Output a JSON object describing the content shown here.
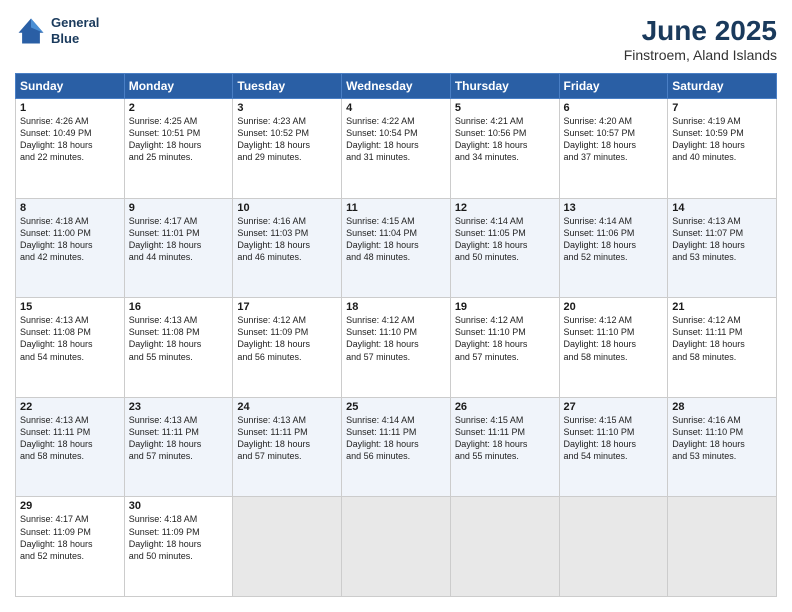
{
  "header": {
    "logo_line1": "General",
    "logo_line2": "Blue",
    "title": "June 2025",
    "location": "Finstroem, Aland Islands"
  },
  "weekdays": [
    "Sunday",
    "Monday",
    "Tuesday",
    "Wednesday",
    "Thursday",
    "Friday",
    "Saturday"
  ],
  "weeks": [
    [
      {
        "day": "1",
        "lines": [
          "Sunrise: 4:26 AM",
          "Sunset: 10:49 PM",
          "Daylight: 18 hours",
          "and 22 minutes."
        ]
      },
      {
        "day": "2",
        "lines": [
          "Sunrise: 4:25 AM",
          "Sunset: 10:51 PM",
          "Daylight: 18 hours",
          "and 25 minutes."
        ]
      },
      {
        "day": "3",
        "lines": [
          "Sunrise: 4:23 AM",
          "Sunset: 10:52 PM",
          "Daylight: 18 hours",
          "and 29 minutes."
        ]
      },
      {
        "day": "4",
        "lines": [
          "Sunrise: 4:22 AM",
          "Sunset: 10:54 PM",
          "Daylight: 18 hours",
          "and 31 minutes."
        ]
      },
      {
        "day": "5",
        "lines": [
          "Sunrise: 4:21 AM",
          "Sunset: 10:56 PM",
          "Daylight: 18 hours",
          "and 34 minutes."
        ]
      },
      {
        "day": "6",
        "lines": [
          "Sunrise: 4:20 AM",
          "Sunset: 10:57 PM",
          "Daylight: 18 hours",
          "and 37 minutes."
        ]
      },
      {
        "day": "7",
        "lines": [
          "Sunrise: 4:19 AM",
          "Sunset: 10:59 PM",
          "Daylight: 18 hours",
          "and 40 minutes."
        ]
      }
    ],
    [
      {
        "day": "8",
        "lines": [
          "Sunrise: 4:18 AM",
          "Sunset: 11:00 PM",
          "Daylight: 18 hours",
          "and 42 minutes."
        ]
      },
      {
        "day": "9",
        "lines": [
          "Sunrise: 4:17 AM",
          "Sunset: 11:01 PM",
          "Daylight: 18 hours",
          "and 44 minutes."
        ]
      },
      {
        "day": "10",
        "lines": [
          "Sunrise: 4:16 AM",
          "Sunset: 11:03 PM",
          "Daylight: 18 hours",
          "and 46 minutes."
        ]
      },
      {
        "day": "11",
        "lines": [
          "Sunrise: 4:15 AM",
          "Sunset: 11:04 PM",
          "Daylight: 18 hours",
          "and 48 minutes."
        ]
      },
      {
        "day": "12",
        "lines": [
          "Sunrise: 4:14 AM",
          "Sunset: 11:05 PM",
          "Daylight: 18 hours",
          "and 50 minutes."
        ]
      },
      {
        "day": "13",
        "lines": [
          "Sunrise: 4:14 AM",
          "Sunset: 11:06 PM",
          "Daylight: 18 hours",
          "and 52 minutes."
        ]
      },
      {
        "day": "14",
        "lines": [
          "Sunrise: 4:13 AM",
          "Sunset: 11:07 PM",
          "Daylight: 18 hours",
          "and 53 minutes."
        ]
      }
    ],
    [
      {
        "day": "15",
        "lines": [
          "Sunrise: 4:13 AM",
          "Sunset: 11:08 PM",
          "Daylight: 18 hours",
          "and 54 minutes."
        ]
      },
      {
        "day": "16",
        "lines": [
          "Sunrise: 4:13 AM",
          "Sunset: 11:08 PM",
          "Daylight: 18 hours",
          "and 55 minutes."
        ]
      },
      {
        "day": "17",
        "lines": [
          "Sunrise: 4:12 AM",
          "Sunset: 11:09 PM",
          "Daylight: 18 hours",
          "and 56 minutes."
        ]
      },
      {
        "day": "18",
        "lines": [
          "Sunrise: 4:12 AM",
          "Sunset: 11:10 PM",
          "Daylight: 18 hours",
          "and 57 minutes."
        ]
      },
      {
        "day": "19",
        "lines": [
          "Sunrise: 4:12 AM",
          "Sunset: 11:10 PM",
          "Daylight: 18 hours",
          "and 57 minutes."
        ]
      },
      {
        "day": "20",
        "lines": [
          "Sunrise: 4:12 AM",
          "Sunset: 11:10 PM",
          "Daylight: 18 hours",
          "and 58 minutes."
        ]
      },
      {
        "day": "21",
        "lines": [
          "Sunrise: 4:12 AM",
          "Sunset: 11:11 PM",
          "Daylight: 18 hours",
          "and 58 minutes."
        ]
      }
    ],
    [
      {
        "day": "22",
        "lines": [
          "Sunrise: 4:13 AM",
          "Sunset: 11:11 PM",
          "Daylight: 18 hours",
          "and 58 minutes."
        ]
      },
      {
        "day": "23",
        "lines": [
          "Sunrise: 4:13 AM",
          "Sunset: 11:11 PM",
          "Daylight: 18 hours",
          "and 57 minutes."
        ]
      },
      {
        "day": "24",
        "lines": [
          "Sunrise: 4:13 AM",
          "Sunset: 11:11 PM",
          "Daylight: 18 hours",
          "and 57 minutes."
        ]
      },
      {
        "day": "25",
        "lines": [
          "Sunrise: 4:14 AM",
          "Sunset: 11:11 PM",
          "Daylight: 18 hours",
          "and 56 minutes."
        ]
      },
      {
        "day": "26",
        "lines": [
          "Sunrise: 4:15 AM",
          "Sunset: 11:11 PM",
          "Daylight: 18 hours",
          "and 55 minutes."
        ]
      },
      {
        "day": "27",
        "lines": [
          "Sunrise: 4:15 AM",
          "Sunset: 11:10 PM",
          "Daylight: 18 hours",
          "and 54 minutes."
        ]
      },
      {
        "day": "28",
        "lines": [
          "Sunrise: 4:16 AM",
          "Sunset: 11:10 PM",
          "Daylight: 18 hours",
          "and 53 minutes."
        ]
      }
    ],
    [
      {
        "day": "29",
        "lines": [
          "Sunrise: 4:17 AM",
          "Sunset: 11:09 PM",
          "Daylight: 18 hours",
          "and 52 minutes."
        ]
      },
      {
        "day": "30",
        "lines": [
          "Sunrise: 4:18 AM",
          "Sunset: 11:09 PM",
          "Daylight: 18 hours",
          "and 50 minutes."
        ]
      },
      {
        "day": "",
        "lines": []
      },
      {
        "day": "",
        "lines": []
      },
      {
        "day": "",
        "lines": []
      },
      {
        "day": "",
        "lines": []
      },
      {
        "day": "",
        "lines": []
      }
    ]
  ]
}
